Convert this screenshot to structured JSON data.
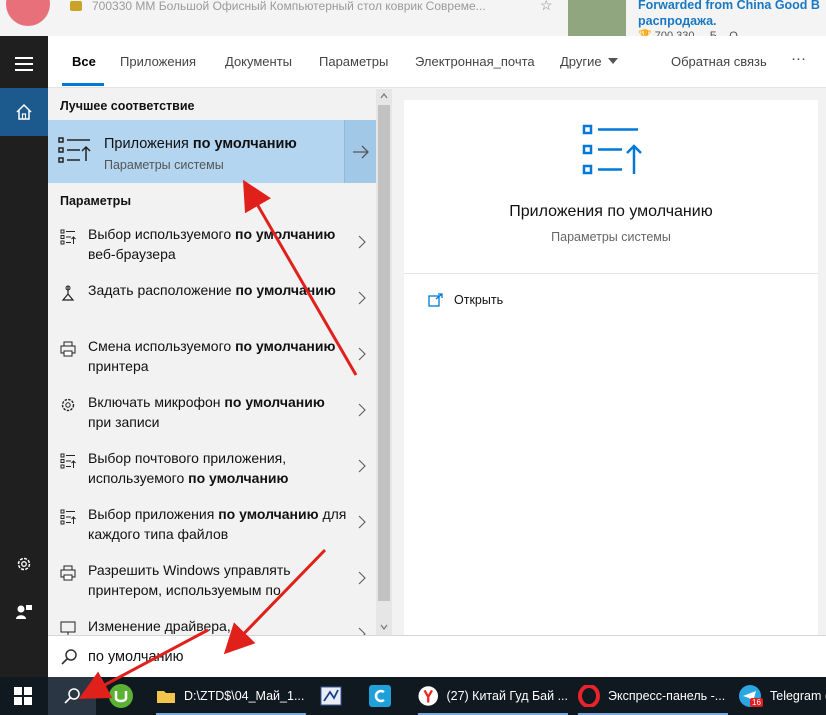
{
  "background": {
    "product_text": "700330 ММ Большой Офисный Компьютерный стол коврик Совреме...",
    "forwarded_line1": "Forwarded from China Good B",
    "forwarded_line2": "распродажа.",
    "forwarded_tail": "🏆 700 330 ... Б... О..."
  },
  "tabs": {
    "all": "Все",
    "apps": "Приложения",
    "docs": "Документы",
    "settings": "Параметры",
    "email": "Электронная_почта",
    "other": "Другие",
    "feedback": "Обратная связь",
    "more": "···"
  },
  "results": {
    "best_header": "Лучшее соответствие",
    "best_title_normal": "Приложения ",
    "best_title_bold": "по умолчанию",
    "best_sub": "Параметры системы",
    "settings_header": "Параметры",
    "items": [
      {
        "a": "Выбор используемого ",
        "b": "по умолчанию",
        "c": " веб-браузера",
        "icon": "list-icon"
      },
      {
        "a": "Задать расположение ",
        "b": "по умолчанию",
        "c": "",
        "icon": "location-icon"
      },
      {
        "a": "Смена используемого ",
        "b": "по умолчанию",
        "c": " принтера",
        "icon": "printer-icon"
      },
      {
        "a": "Включать микрофон ",
        "b": "по умолчанию",
        "c": " при записи",
        "icon": "gear-icon"
      },
      {
        "a": "Выбор почтового приложения, используемого ",
        "b": "по умолчанию",
        "c": "",
        "icon": "list-icon"
      },
      {
        "a": "Выбор приложения ",
        "b": "по умолчанию",
        "c": " для каждого типа файлов",
        "icon": "list-icon"
      },
      {
        "a": "Разрешить Windows управлять принтером, используемым по",
        "b": "",
        "c": "",
        "icon": "printer-icon"
      },
      {
        "a": "Изменение драйвера,",
        "b": "",
        "c": "",
        "icon": "monitor-icon"
      }
    ]
  },
  "preview": {
    "title": "Приложения по умолчанию",
    "subtitle": "Параметры системы",
    "open": "Открыть"
  },
  "search": {
    "query": "по умолчанию"
  },
  "taskbar": {
    "folder": "D:\\ZTD$\\04_Май_1...",
    "yandex": "(27) Китай Гуд Бай ...",
    "opera": "Экспресс-панель -...",
    "telegram": "Telegram (",
    "telegram_badge": "16"
  },
  "colors": {
    "accent": "#0078d7",
    "highlight": "#b3d5f0",
    "annotation_red": "#e0201b"
  }
}
